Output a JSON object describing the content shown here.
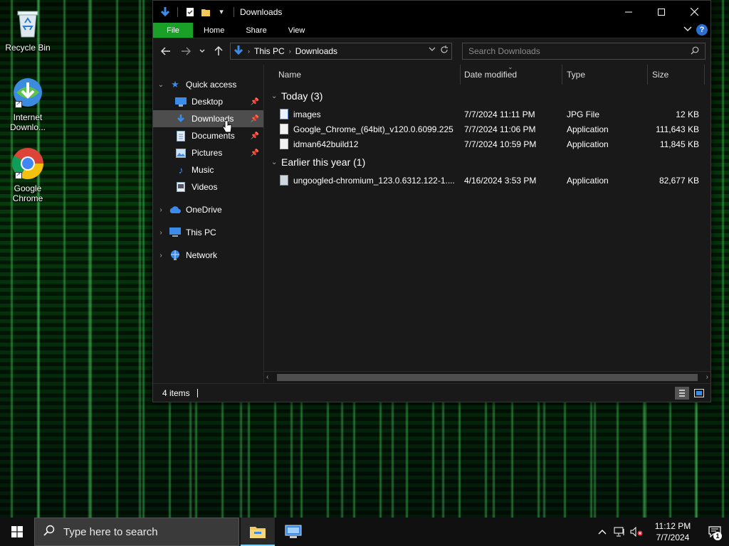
{
  "desktop": {
    "icons": [
      {
        "label": "Recycle Bin",
        "icon": "recycle-bin-icon"
      },
      {
        "label": "Internet Downlo...",
        "icon": "internet-download-manager-icon"
      },
      {
        "label": "Google Chrome",
        "icon": "google-chrome-icon"
      }
    ]
  },
  "window": {
    "title": "Downloads",
    "ribbon_tabs": [
      "File",
      "Home",
      "Share",
      "View"
    ],
    "help_label": "?",
    "address": {
      "crumbs": [
        "This PC",
        "Downloads"
      ]
    },
    "search": {
      "placeholder": "Search Downloads"
    },
    "nav": {
      "quick_access": "Quick access",
      "children": [
        {
          "label": "Desktop",
          "icon": "desktop-folder-icon",
          "pinned": true
        },
        {
          "label": "Downloads",
          "icon": "downloads-folder-icon",
          "pinned": true,
          "selected": true
        },
        {
          "label": "Documents",
          "icon": "documents-folder-icon",
          "pinned": true
        },
        {
          "label": "Pictures",
          "icon": "pictures-folder-icon",
          "pinned": true
        },
        {
          "label": "Music",
          "icon": "music-folder-icon",
          "pinned": false
        },
        {
          "label": "Videos",
          "icon": "videos-folder-icon",
          "pinned": false
        }
      ],
      "onedrive": "OneDrive",
      "this_pc": "This PC",
      "network": "Network"
    },
    "columns": [
      "Name",
      "Date modified",
      "Type",
      "Size"
    ],
    "groups": [
      {
        "label": "Today (3)",
        "files": [
          {
            "name": "images",
            "date": "7/7/2024 11:11 PM",
            "type": "JPG File",
            "size": "12 KB",
            "icon": "jpg-file-icon"
          },
          {
            "name": "Google_Chrome_(64bit)_v120.0.6099.225",
            "date": "7/7/2024 11:06 PM",
            "type": "Application",
            "size": "111,643 KB",
            "icon": "application-file-icon"
          },
          {
            "name": "idman642build12",
            "date": "7/7/2024 10:59 PM",
            "type": "Application",
            "size": "11,845 KB",
            "icon": "application-file-icon"
          }
        ]
      },
      {
        "label": "Earlier this year (1)",
        "files": [
          {
            "name": "ungoogled-chromium_123.0.6312.122-1....",
            "date": "4/16/2024 3:53 PM",
            "type": "Application",
            "size": "82,677 KB",
            "icon": "installer-file-icon"
          }
        ]
      }
    ],
    "status": "4 items"
  },
  "taskbar": {
    "search_placeholder": "Type here to search",
    "clock_time": "11:12 PM",
    "clock_date": "7/7/2024",
    "notification_count": "1"
  },
  "colors": {
    "file_tab": "#1a9f29",
    "selected_nav": "#4d4d4d",
    "window_bg": "#191919",
    "taskbar_bg": "#101010"
  }
}
